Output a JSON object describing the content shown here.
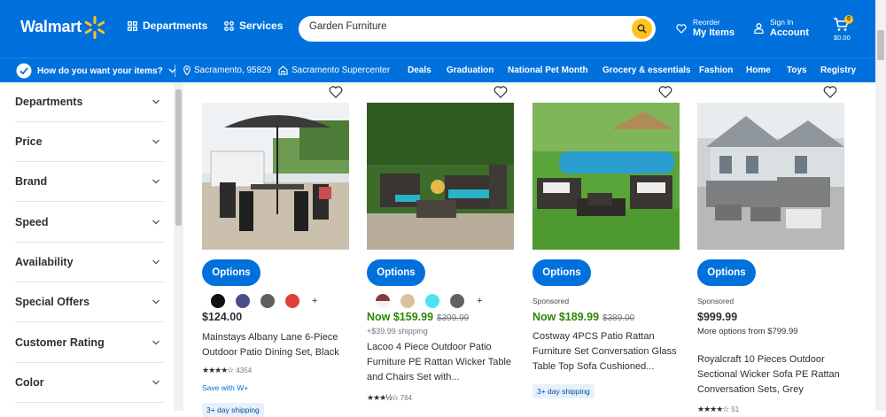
{
  "header": {
    "logo": "Walmart",
    "departments": "Departments",
    "services": "Services",
    "search_value": "Garden Furniture",
    "reorder_small": "Reorder",
    "reorder_big": "My Items",
    "signin_small": "Sign In",
    "signin_big": "Account",
    "cart_count": "0",
    "cart_total": "$0.00"
  },
  "subnav": {
    "how": "How do you want your items?",
    "location": "Sacramento, 95829",
    "store": "Sacramento Supercenter",
    "links": [
      "Deals",
      "Graduation",
      "National Pet Month",
      "Grocery & essentials",
      "Fashion",
      "Home",
      "Toys",
      "Registry"
    ]
  },
  "facets": [
    "Departments",
    "Price",
    "Brand",
    "Speed",
    "Availability",
    "Special Offers",
    "Customer Rating",
    "Color"
  ],
  "products": [
    {
      "options": "Options",
      "swatches": [
        "#111111",
        "#4b4c8c",
        "#5f5f5f",
        "#e0403a"
      ],
      "plus": "+",
      "price": "$124.00",
      "title": "Mainstays Albany Lane 6-Piece Outdoor Patio Dining Set, Black",
      "stars": "★★★★☆",
      "reviews": "4354",
      "save_with": "Save with W+",
      "shipping": "3+ day shipping"
    },
    {
      "options": "Options",
      "swatches": [
        "#8a3a3a",
        "#d8c0a0",
        "#4fe3f0",
        "#626262"
      ],
      "plus": "+",
      "price": "Now $159.99",
      "was": "$399.99",
      "sub": "+$39.99 shipping",
      "title": "Lacoo 4 Piece Outdoor Patio Furniture PE Rattan Wicker Table and Chairs Set with...",
      "stars": "★★★½☆",
      "reviews": "764"
    },
    {
      "options": "Options",
      "sponsored": "Sponsored",
      "price": "Now $189.99",
      "was": "$389.00",
      "title": "Costway 4PCS Patio Rattan Furniture Set Conversation Glass Table Top Sofa Cushioned...",
      "shipping": "3+ day shipping"
    },
    {
      "options": "Options",
      "sponsored": "Sponsored",
      "price": "$999.99",
      "sub": "More options from $799.99",
      "title": "Royalcraft 10 Pieces Outdoor Sectional Wicker Sofa PE Rattan Conversation Sets, Grey",
      "stars": "★★★★☆",
      "reviews": "51"
    }
  ]
}
